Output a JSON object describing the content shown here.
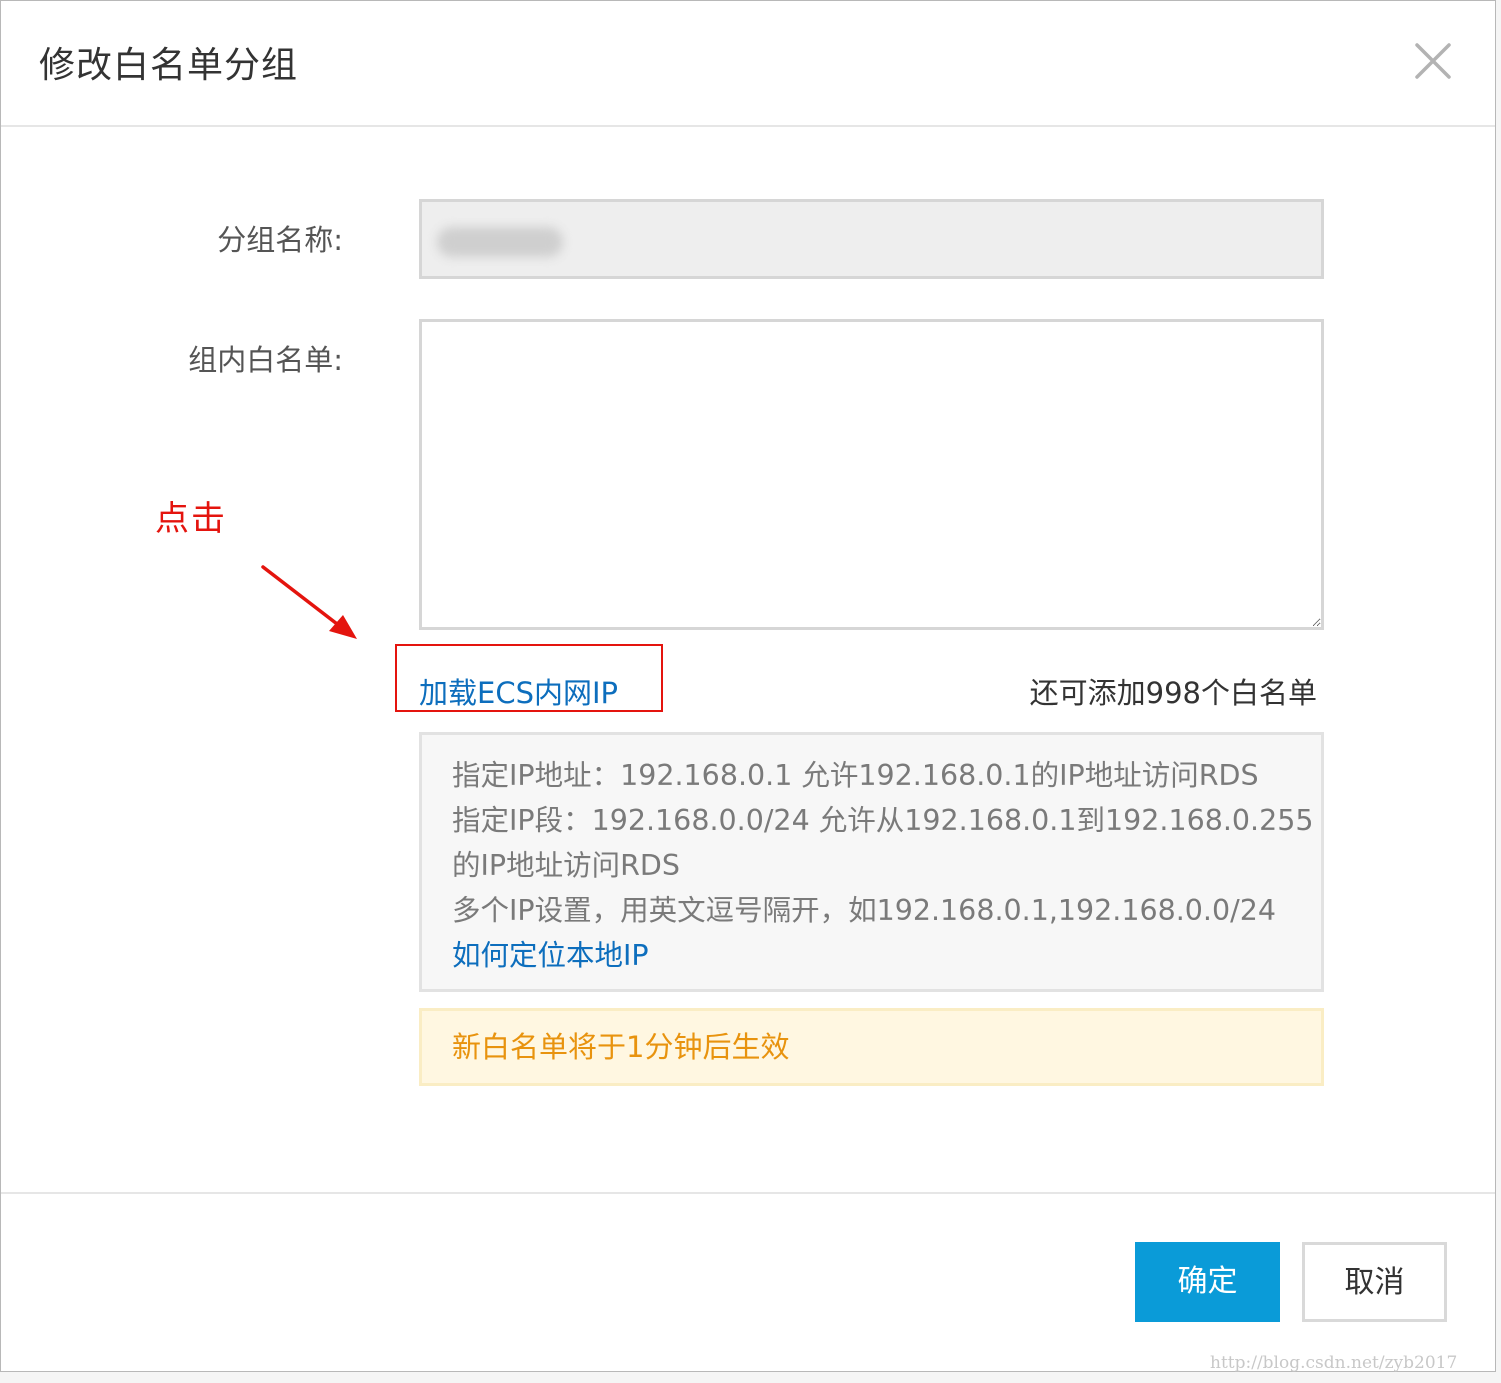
{
  "dialog": {
    "title": "修改白名单分组"
  },
  "form": {
    "group_name_label": "分组名称:",
    "group_name_value": "",
    "whitelist_label": "组内白名单:",
    "whitelist_value": "",
    "load_ecs_link": "加载ECS内网IP",
    "remaining_text": "还可添加998个白名单"
  },
  "tips": {
    "lines": [
      "指定IP地址：192.168.0.1 允许192.168.0.1的IP地址访问RDS",
      "指定IP段：192.168.0.0/24 允许从192.168.0.1到192.168.0.255",
      "的IP地址访问RDS",
      "多个IP设置，用英文逗号隔开，如192.168.0.1,192.168.0.0/24"
    ],
    "help_link": "如何定位本地IP"
  },
  "notice": {
    "text": "新白名单将于1分钟后生效"
  },
  "annotation": {
    "text": "点击",
    "color": "#e4140e"
  },
  "buttons": {
    "confirm_label": "确定",
    "cancel_label": "取消"
  },
  "watermark": "http://blog.csdn.net/zyb2017",
  "colors": {
    "link": "#0d6ebd",
    "primary_button": "#0a9bd8",
    "notice_text": "#e8930e",
    "notice_bg": "#fff7e1"
  },
  "icons": {
    "close": "close-icon",
    "arrow": "arrow-icon"
  }
}
